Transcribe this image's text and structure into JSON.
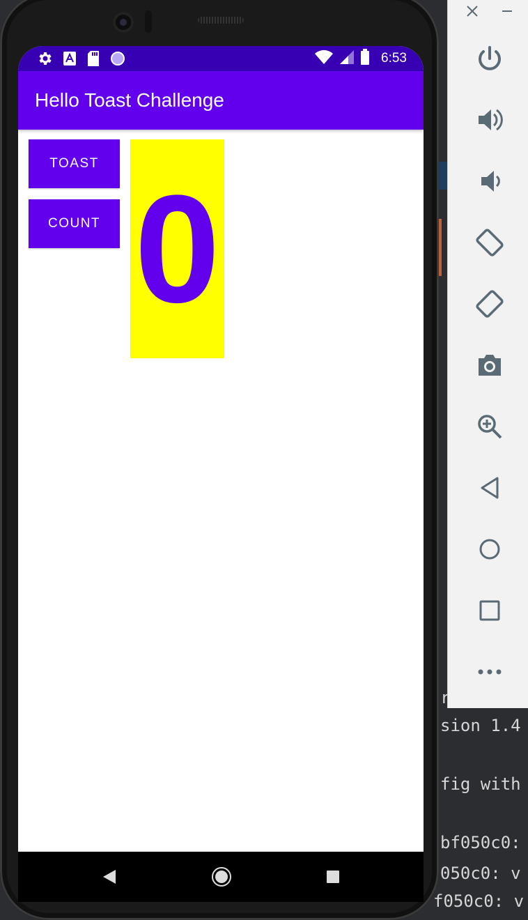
{
  "status_bar": {
    "time": "6:53",
    "icons_left": [
      "gear-icon",
      "font-a-icon",
      "sd-card-icon",
      "loading-circle-icon"
    ],
    "icons_right": [
      "wifi-icon",
      "signal-icon",
      "battery-icon"
    ]
  },
  "app": {
    "title": "Hello Toast Challenge",
    "toast_label": "TOAST",
    "count_label": "COUNT",
    "count_value": "0"
  },
  "nav_bar": {
    "icons": [
      "back-triangle-icon",
      "home-circle-icon",
      "recents-square-icon"
    ]
  },
  "emulator_toolbar": {
    "window_buttons": [
      "close-icon",
      "minimize-icon"
    ],
    "tools": [
      "power-icon",
      "volume-up-icon",
      "volume-down-icon",
      "rotate-left-icon",
      "rotate-right-icon",
      "camera-icon",
      "zoom-icon",
      "back-icon",
      "home-icon",
      "overview-icon",
      "more-icon"
    ]
  },
  "ide_console": {
    "lines": [
      "r",
      "sion 1.4",
      "fig with",
      "bf050c0:",
      "050c0: v",
      "f050c0: v"
    ]
  },
  "colors": {
    "primary": "#6200ee",
    "primary_dark": "#3700b3",
    "count_background": "#ffff00"
  }
}
